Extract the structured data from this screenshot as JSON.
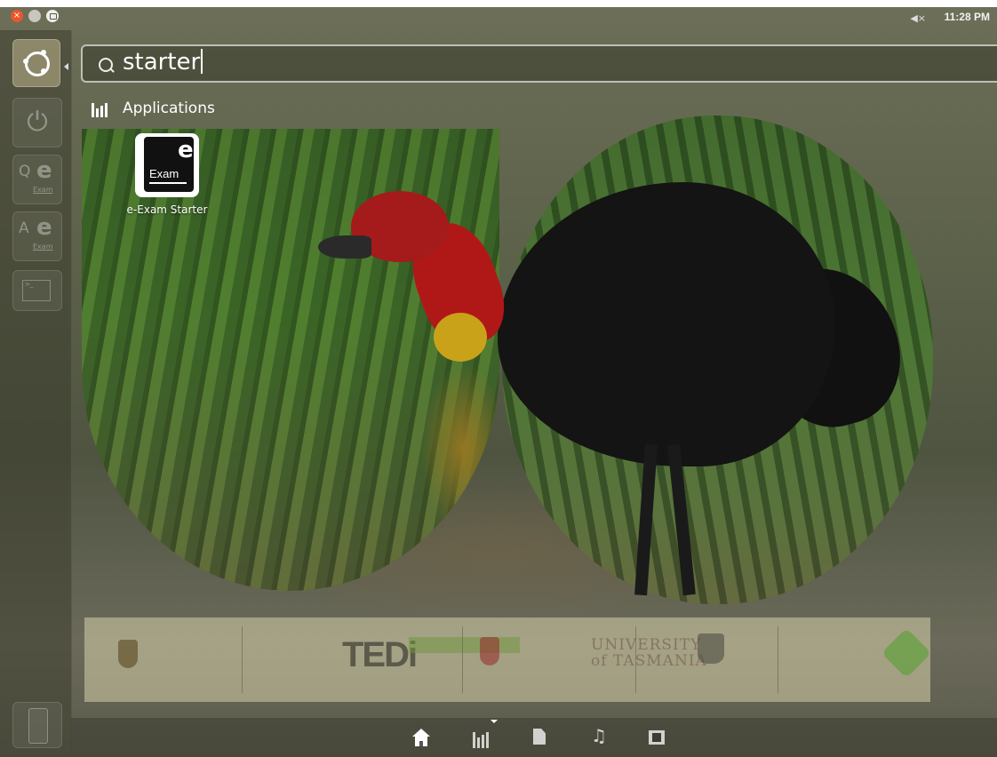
{
  "top_panel": {
    "clock": "11:28 PM",
    "volume_icon": "volume-muted-icon"
  },
  "search": {
    "query": "starter"
  },
  "results": {
    "category_label": "Applications",
    "apps": [
      {
        "label": "e-Exam Starter",
        "icon_letter": "e",
        "icon_word": "Exam"
      }
    ]
  },
  "launcher": {
    "items": [
      {
        "name": "ubuntu-dash-icon"
      },
      {
        "name": "power-icon"
      },
      {
        "name": "qe-exam-icon",
        "letters": "Q",
        "e": "e",
        "sub": "Exam"
      },
      {
        "name": "ae-exam-icon",
        "letters": "A",
        "e": "e",
        "sub": "Exam"
      },
      {
        "name": "terminal-icon"
      },
      {
        "name": "trash-icon"
      }
    ]
  },
  "lenses": [
    "home-icon",
    "applications-icon",
    "files-icon",
    "music-icon",
    "video-icon"
  ],
  "colors": {
    "close_button": "#e8562b",
    "accent_text": "#ffffff"
  }
}
